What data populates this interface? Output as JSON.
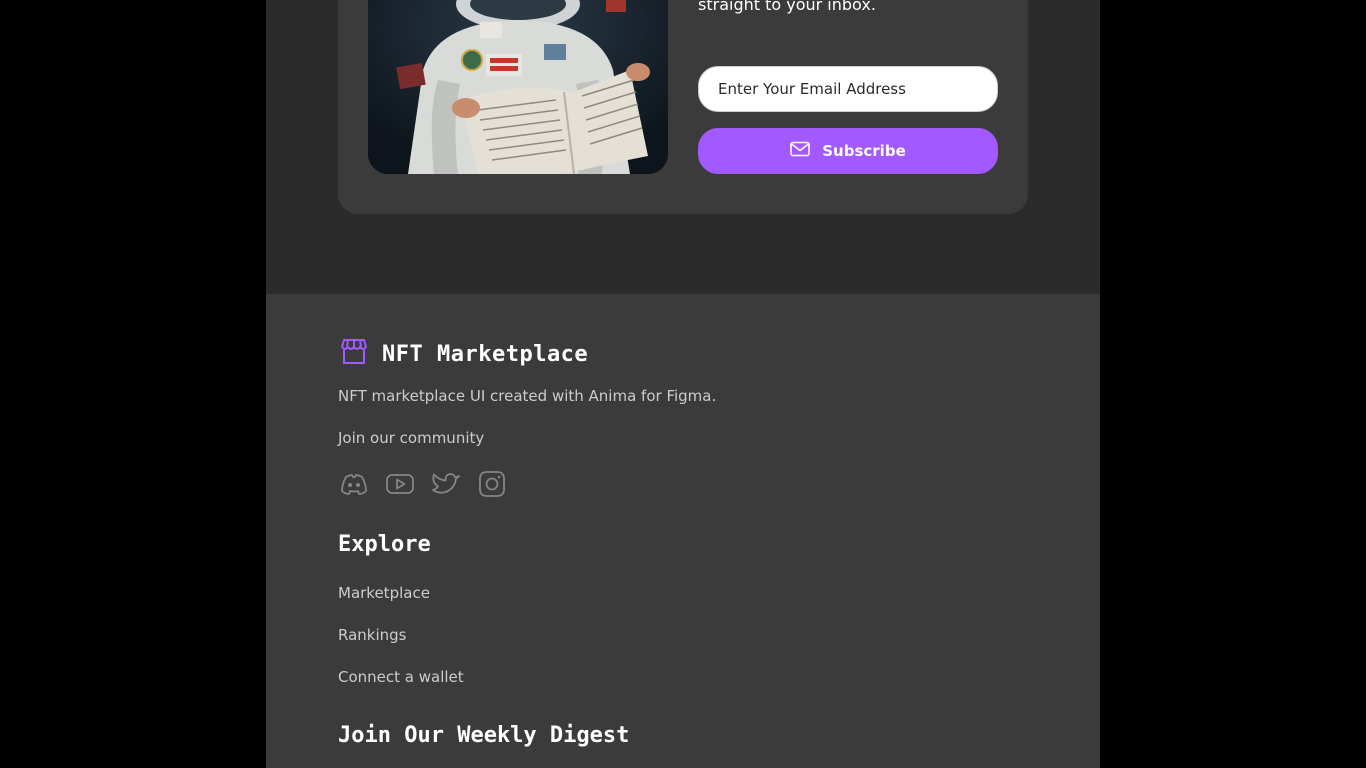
{
  "subscribe_card": {
    "text": "straight to your inbox.",
    "email_placeholder": "Enter Your Email Address",
    "subscribe_label": "Subscribe",
    "image_icon": "astronaut-reading-newspaper",
    "button_icon": "mail-icon"
  },
  "footer": {
    "brand_title": "NFT Marketplace",
    "brand_icon": "storefront-icon",
    "tagline": "NFT marketplace UI created with Anima for Figma.",
    "join_text": "Join our community",
    "socials": [
      {
        "icon": "discord-icon"
      },
      {
        "icon": "youtube-icon"
      },
      {
        "icon": "twitter-icon"
      },
      {
        "icon": "instagram-icon"
      }
    ],
    "explore_heading": "Explore",
    "explore_links": [
      "Marketplace",
      "Rankings",
      "Connect a wallet"
    ],
    "digest_heading": "Join Our Weekly Digest"
  },
  "colors": {
    "accent": "#a259ff",
    "background": "#2b2b2b",
    "card": "#3b3b3b",
    "muted_text": "#cccccc"
  }
}
